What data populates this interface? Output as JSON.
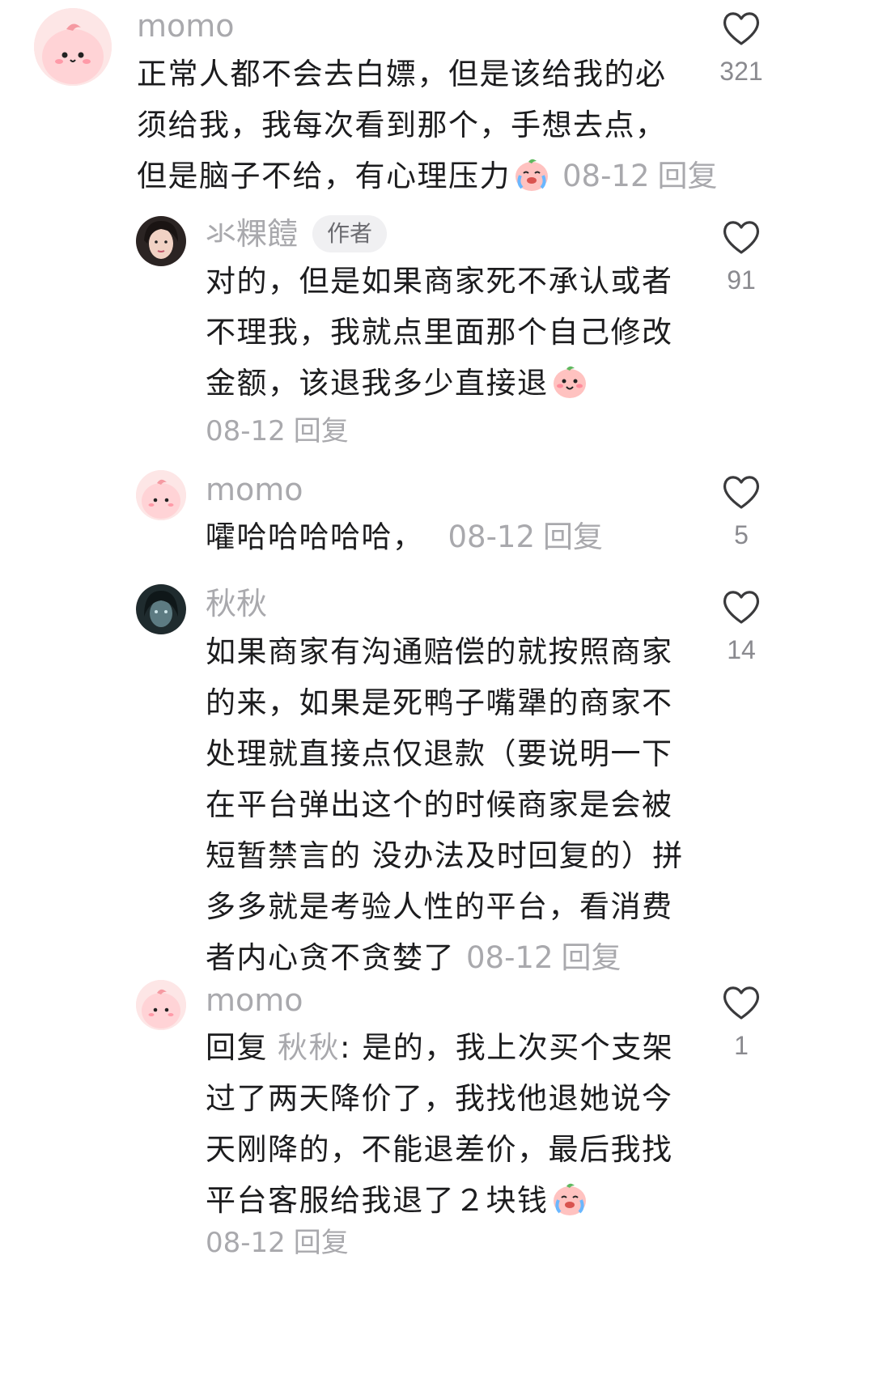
{
  "comments": [
    {
      "username": "momo",
      "text_lines": [
        "正常人都不会去白嫖，但是该给我的必",
        "须给我，我每次看到那个，手想去点，",
        "但是脑子不给，有心理压力"
      ],
      "emoji": "crying-laughing-peach-emoji",
      "date": "08-12",
      "reply_label": "回复",
      "likes": "321"
    },
    {
      "username": "氺粿饐",
      "badge": "作者",
      "text_lines": [
        "对的，但是如果商家死不承认或者",
        "不理我，我就点里面那个自己修改",
        "金额，该退我多少直接退"
      ],
      "emoji": "smiling-peach-emoji",
      "date": "08-12",
      "reply_label": "回复",
      "likes": "91"
    },
    {
      "username": "momo",
      "text_lines": [
        "嚯哈哈哈哈哈，"
      ],
      "date": "08-12",
      "reply_label": "回复",
      "likes": "5"
    },
    {
      "username": "秋秋",
      "text_lines": [
        "如果商家有沟通赔偿的就按照商家",
        "的来，如果是死鸭子嘴犟的商家不",
        "处理就直接点仅退款（要说明一下",
        "在平台弹出这个的时候商家是会被",
        "短暂禁言的 没办法及时回复的）拼",
        "多多就是考验人性的平台，看消费",
        "者内心贪不贪婪了"
      ],
      "date": "08-12",
      "reply_label": "回复",
      "likes": "14"
    },
    {
      "username": "momo",
      "reply_prefix": "回复",
      "reply_target": "秋秋",
      "text_lines": [
        ": 是的，我上次买个支架",
        "过了两天降价了，我找他退她说今",
        "天刚降的，不能退差价，最后我找",
        "平台客服给我退了２块钱"
      ],
      "emoji": "crying-laughing-peach-emoji",
      "date": "08-12",
      "reply_label": "回复",
      "likes": "1"
    }
  ],
  "colors": {
    "primary_text": "#1c1c1e",
    "secondary_text": "#a9a9ad",
    "badge_bg": "#f0f0f2",
    "icon_stroke": "#3a3a3c"
  },
  "icons": {
    "like": "heart-outline-icon"
  }
}
